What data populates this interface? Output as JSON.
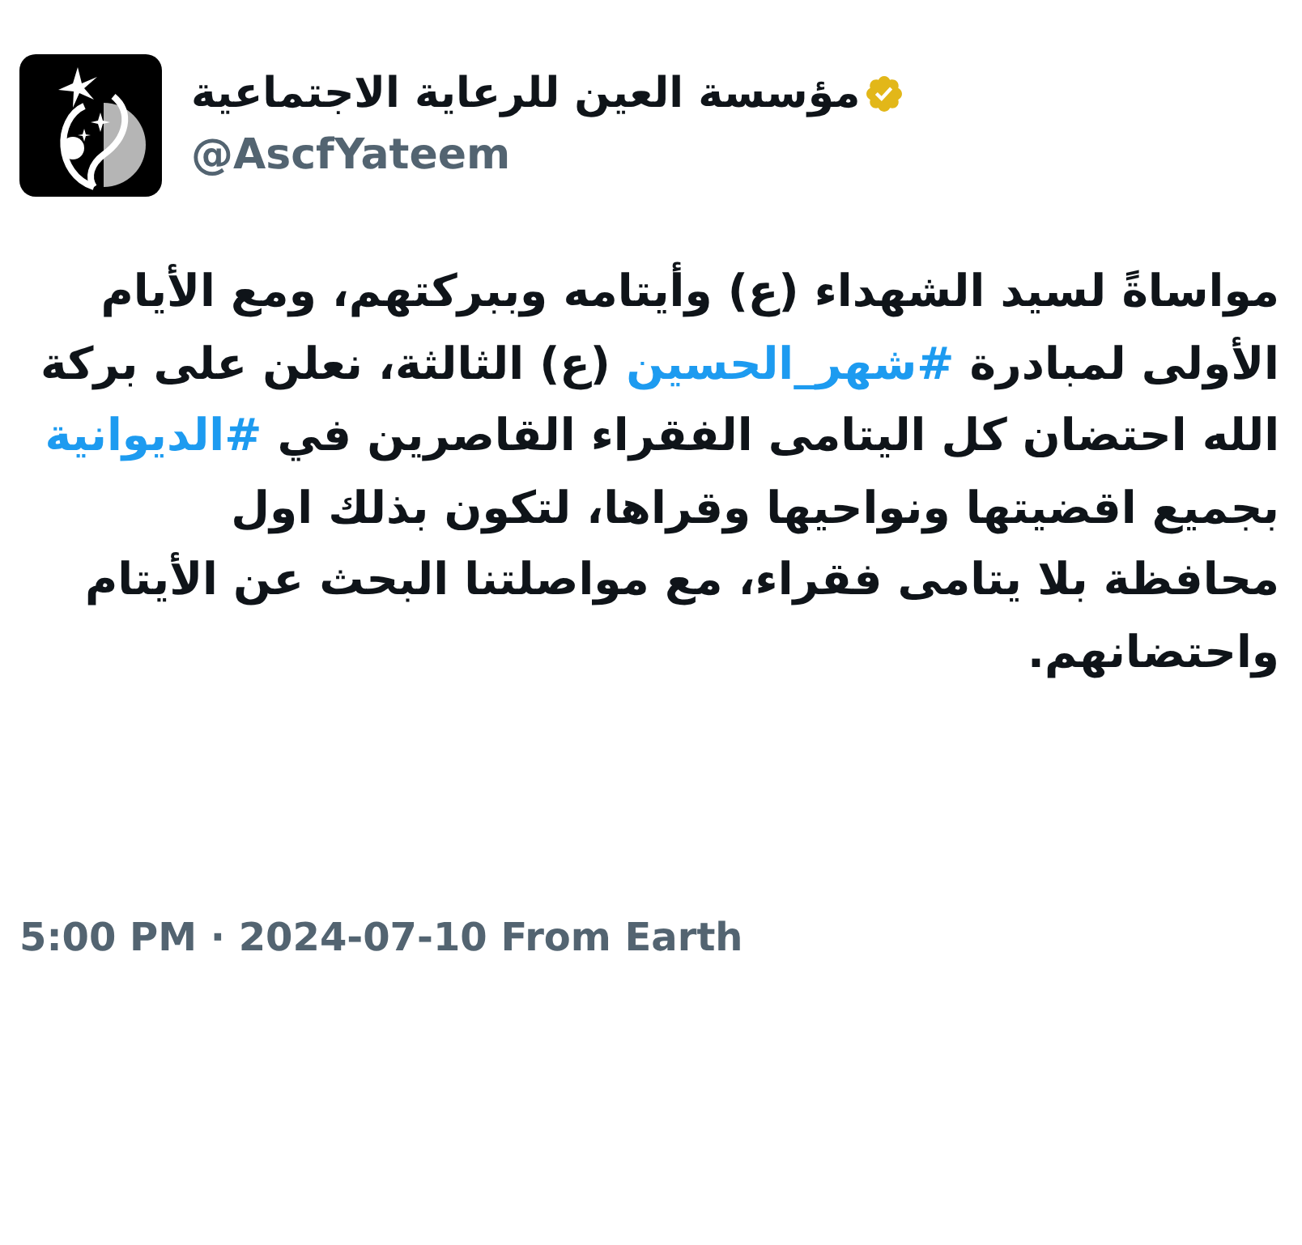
{
  "author": {
    "name": "مؤسسة العين للرعاية الاجتماعية",
    "verified": true,
    "handle": "@AscfYateem"
  },
  "post": {
    "lines": [
      [
        {
          "kind": "text",
          "text": "مواساةً لسيد الشهداء (ع) وأيتامه وببركتهم، ومع الأيام"
        }
      ],
      [
        {
          "kind": "text",
          "text": "الأولى لمبادرة "
        },
        {
          "kind": "hashtag",
          "text": "#شهر_الحسين"
        },
        {
          "kind": "text",
          "text": " (ع) الثالثة، نعلن على بركة"
        }
      ],
      [
        {
          "kind": "text",
          "text": "الله احتضان كل اليتامى الفقراء القاصرين في "
        },
        {
          "kind": "hashtag",
          "text": "#الديوانية"
        }
      ],
      [
        {
          "kind": "text",
          "text": "بجميع اقضيتها ونواحيها وقراها، لتكون بذلك اول"
        }
      ],
      [
        {
          "kind": "text",
          "text": "محافظة بلا يتامى فقراء، مع مواصلتنا البحث عن الأيتام"
        }
      ],
      [
        {
          "kind": "text",
          "text": "واحتضانهم."
        }
      ]
    ],
    "timestamp": "5:00 PM · 2024-07-10 From Earth"
  }
}
